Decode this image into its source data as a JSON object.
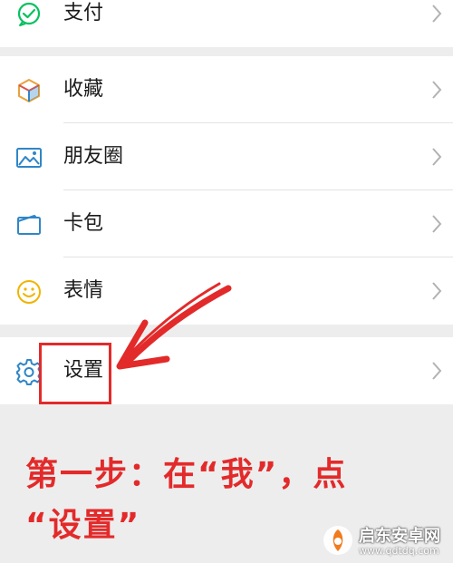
{
  "menu": {
    "pay": {
      "label": "支付",
      "icon": "wechat-pay-icon"
    },
    "items": [
      {
        "label": "收藏",
        "icon": "favorites-cube-icon"
      },
      {
        "label": "朋友圈",
        "icon": "moments-image-icon"
      },
      {
        "label": "卡包",
        "icon": "card-wallet-icon"
      },
      {
        "label": "表情",
        "icon": "emoji-smile-icon"
      }
    ],
    "settings": {
      "label": "设置",
      "icon": "gear-icon"
    }
  },
  "annotation": {
    "caption_line1": "第一步：在“我”，点",
    "caption_line2": "“设置”",
    "color": "#e32a2a"
  },
  "watermark": {
    "name": "启东安卓网",
    "url": "www.qdtdq.com"
  },
  "colors": {
    "icon_green": "#07c160",
    "icon_blue": "#2f86c8",
    "icon_yellow": "#f0b400",
    "background": "#ededed"
  }
}
